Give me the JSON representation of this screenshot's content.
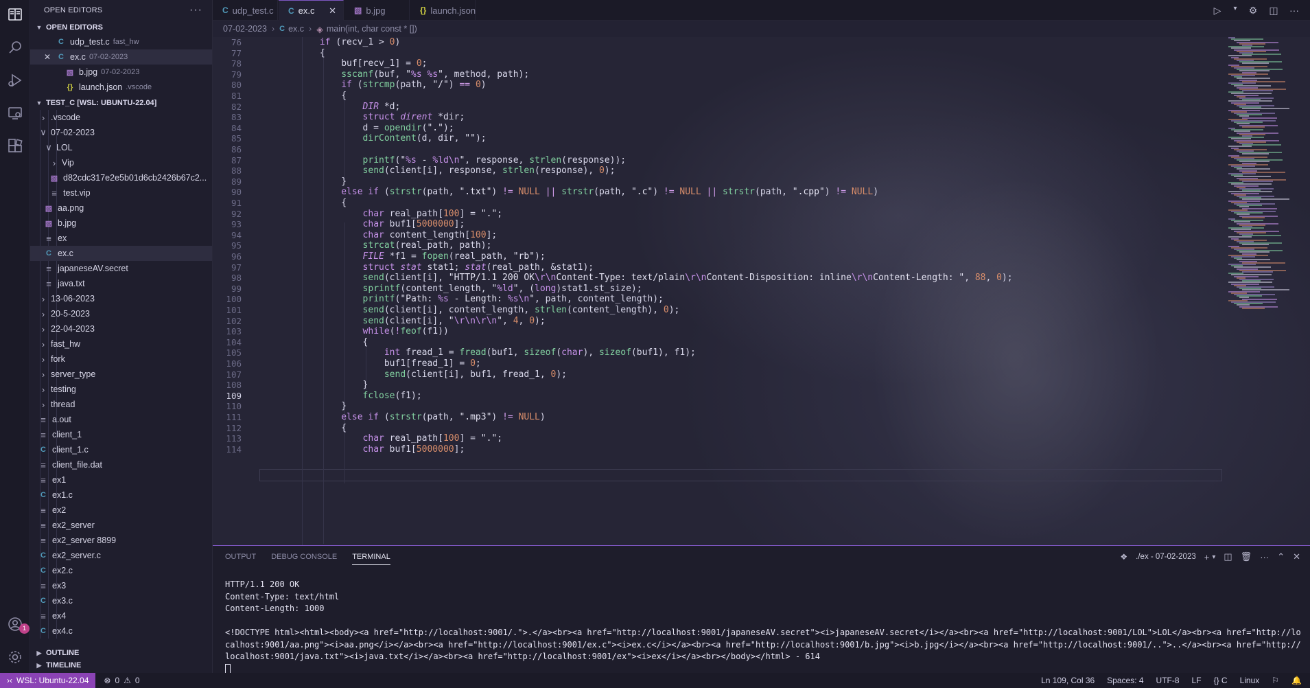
{
  "window": {
    "title": "ex.c - TEST_C [WSL: UBUNTU-22.04]"
  },
  "sidebar": {
    "header": "OPEN EDITORS",
    "open_editors_label": "OPEN EDITORS",
    "open_editors": [
      {
        "name": "udp_test.c",
        "desc": "fast_hw",
        "type": "c"
      },
      {
        "name": "ex.c",
        "desc": "07-02-2023",
        "type": "c"
      },
      {
        "name": "b.jpg",
        "desc": "07-02-2023",
        "type": "img"
      },
      {
        "name": "launch.json",
        "desc": ".vscode",
        "type": "json"
      }
    ],
    "workspace_label": "TEST_C [WSL: UBUNTU-22.04]",
    "tree": [
      {
        "label": ".vscode",
        "depth": 1,
        "kind": "folder-closed"
      },
      {
        "label": "07-02-2023",
        "depth": 1,
        "kind": "folder-open"
      },
      {
        "label": "LOL",
        "depth": 2,
        "kind": "folder-open"
      },
      {
        "label": "Vip",
        "depth": 3,
        "kind": "folder-closed"
      },
      {
        "label": "d82cdc317e2e5b01d6cb2426b67c2...",
        "depth": 3,
        "kind": "img"
      },
      {
        "label": "test.vip",
        "depth": 3,
        "kind": "txt"
      },
      {
        "label": "aa.png",
        "depth": 2,
        "kind": "img"
      },
      {
        "label": "b.jpg",
        "depth": 2,
        "kind": "img"
      },
      {
        "label": "ex",
        "depth": 2,
        "kind": "txt"
      },
      {
        "label": "ex.c",
        "depth": 2,
        "kind": "c"
      },
      {
        "label": "japaneseAV.secret",
        "depth": 2,
        "kind": "txt"
      },
      {
        "label": "java.txt",
        "depth": 2,
        "kind": "txt"
      },
      {
        "label": "13-06-2023",
        "depth": 1,
        "kind": "folder-closed"
      },
      {
        "label": "20-5-2023",
        "depth": 1,
        "kind": "folder-closed"
      },
      {
        "label": "22-04-2023",
        "depth": 1,
        "kind": "folder-closed"
      },
      {
        "label": "fast_hw",
        "depth": 1,
        "kind": "folder-closed"
      },
      {
        "label": "fork",
        "depth": 1,
        "kind": "folder-closed"
      },
      {
        "label": "server_type",
        "depth": 1,
        "kind": "folder-closed"
      },
      {
        "label": "testing",
        "depth": 1,
        "kind": "folder-closed"
      },
      {
        "label": "thread",
        "depth": 1,
        "kind": "folder-closed"
      },
      {
        "label": "a.out",
        "depth": 1,
        "kind": "txt"
      },
      {
        "label": "client_1",
        "depth": 1,
        "kind": "txt"
      },
      {
        "label": "client_1.c",
        "depth": 1,
        "kind": "c"
      },
      {
        "label": "client_file.dat",
        "depth": 1,
        "kind": "txt"
      },
      {
        "label": "ex1",
        "depth": 1,
        "kind": "txt"
      },
      {
        "label": "ex1.c",
        "depth": 1,
        "kind": "c"
      },
      {
        "label": "ex2",
        "depth": 1,
        "kind": "txt"
      },
      {
        "label": "ex2_server",
        "depth": 1,
        "kind": "txt"
      },
      {
        "label": "ex2_server 8899",
        "depth": 1,
        "kind": "txt"
      },
      {
        "label": "ex2_server.c",
        "depth": 1,
        "kind": "c"
      },
      {
        "label": "ex2.c",
        "depth": 1,
        "kind": "c"
      },
      {
        "label": "ex3",
        "depth": 1,
        "kind": "txt"
      },
      {
        "label": "ex3.c",
        "depth": 1,
        "kind": "c"
      },
      {
        "label": "ex4",
        "depth": 1,
        "kind": "txt"
      },
      {
        "label": "ex4.c",
        "depth": 1,
        "kind": "c"
      }
    ],
    "outline_label": "OUTLINE",
    "timeline_label": "TIMELINE"
  },
  "tabs": [
    {
      "name": "udp_test.c",
      "type": "c",
      "active": false
    },
    {
      "name": "ex.c",
      "type": "c",
      "active": true
    },
    {
      "name": "b.jpg",
      "type": "img",
      "active": false
    },
    {
      "name": "launch.json",
      "type": "json",
      "active": false
    }
  ],
  "breadcrumb": {
    "folder": "07-02-2023",
    "file": "ex.c",
    "symbol": "main(int, char const * [])"
  },
  "editor": {
    "current_line": 109,
    "lines": [
      {
        "n": 76,
        "text": "            if (recv_1 > 0)"
      },
      {
        "n": 77,
        "text": "            {"
      },
      {
        "n": 78,
        "text": "                buf[recv_1] = 0;"
      },
      {
        "n": 79,
        "text": "                sscanf(buf, \"%s %s\", method, path);"
      },
      {
        "n": 80,
        "text": "                if (strcmp(path, \"/\") == 0)"
      },
      {
        "n": 81,
        "text": "                {"
      },
      {
        "n": 82,
        "text": "                    DIR *d;"
      },
      {
        "n": 83,
        "text": "                    struct dirent *dir;"
      },
      {
        "n": 84,
        "text": "                    d = opendir(\".\");"
      },
      {
        "n": 85,
        "text": "                    dirContent(d, dir, \"\");"
      },
      {
        "n": 86,
        "text": ""
      },
      {
        "n": 87,
        "text": "                    printf(\"%s - %ld\\n\", response, strlen(response));"
      },
      {
        "n": 88,
        "text": "                    send(client[i], response, strlen(response), 0);"
      },
      {
        "n": 89,
        "text": "                }"
      },
      {
        "n": 90,
        "text": "                else if (strstr(path, \".txt\") != NULL || strstr(path, \".c\") != NULL || strstr(path, \".cpp\") != NULL)"
      },
      {
        "n": 91,
        "text": "                {"
      },
      {
        "n": 92,
        "text": "                    char real_path[100] = \".\";"
      },
      {
        "n": 93,
        "text": "                    char buf1[5000000];"
      },
      {
        "n": 94,
        "text": "                    char content_length[100];"
      },
      {
        "n": 95,
        "text": "                    strcat(real_path, path);"
      },
      {
        "n": 96,
        "text": "                    FILE *f1 = fopen(real_path, \"rb\");"
      },
      {
        "n": 97,
        "text": "                    struct stat stat1; stat(real_path, &stat1);"
      },
      {
        "n": 98,
        "text": "                    send(client[i], \"HTTP/1.1 200 OK\\r\\nContent-Type: text/plain\\r\\nContent-Disposition: inline\\r\\nContent-Length: \", 88, 0);"
      },
      {
        "n": 99,
        "text": "                    sprintf(content_length, \"%ld\", (long)stat1.st_size);"
      },
      {
        "n": 100,
        "text": "                    printf(\"Path: %s - Length: %s\\n\", path, content_length);"
      },
      {
        "n": 101,
        "text": "                    send(client[i], content_length, strlen(content_length), 0);"
      },
      {
        "n": 102,
        "text": "                    send(client[i], \"\\r\\n\\r\\n\", 4, 0);"
      },
      {
        "n": 103,
        "text": "                    while(!feof(f1))"
      },
      {
        "n": 104,
        "text": "                    {"
      },
      {
        "n": 105,
        "text": "                        int fread_1 = fread(buf1, sizeof(char), sizeof(buf1), f1);"
      },
      {
        "n": 106,
        "text": "                        buf1[fread_1] = 0;"
      },
      {
        "n": 107,
        "text": "                        send(client[i], buf1, fread_1, 0);"
      },
      {
        "n": 108,
        "text": "                    }"
      },
      {
        "n": 109,
        "text": "                    fclose(f1);"
      },
      {
        "n": 110,
        "text": "                }"
      },
      {
        "n": 111,
        "text": "                else if (strstr(path, \".mp3\") != NULL)"
      },
      {
        "n": 112,
        "text": "                {"
      },
      {
        "n": 113,
        "text": "                    char real_path[100] = \".\";"
      },
      {
        "n": 114,
        "text": "                    char buf1[5000000];"
      }
    ]
  },
  "panel": {
    "tabs": [
      {
        "label": "OUTPUT",
        "active": false
      },
      {
        "label": "DEBUG CONSOLE",
        "active": false
      },
      {
        "label": "TERMINAL",
        "active": true
      }
    ],
    "terminal_name": "./ex - 07-02-2023",
    "terminal_lines": [
      "HTTP/1.1 200 OK",
      "Content-Type: text/html",
      "Content-Length: 1000",
      "",
      "<!DOCTYPE html><html><body><a href=\"http://localhost:9001/.\">.</a><br><a href=\"http://localhost:9001/japaneseAV.secret\"><i>japaneseAV.secret</i></a><br><a href=\"http://localhost:9001/LOL\">LOL</a><br><a href=\"http://localhost:9001/aa.png\"><i>aa.png</i></a><br><a href=\"http://localhost:9001/ex.c\"><i>ex.c</i></a><br><a href=\"http://localhost:9001/b.jpg\"><i>b.jpg</i></a><br><a href=\"http://localhost:9001/..\">..</a><br><a href=\"http://localhost:9001/java.txt\"><i>java.txt</i></a><br><a href=\"http://localhost:9001/ex\"><i>ex</i></a><br></body></html> - 614"
    ]
  },
  "status": {
    "remote": "WSL: Ubuntu-22.04",
    "errors": "0",
    "warnings": "0",
    "position": "Ln 109, Col 36",
    "spaces": "Spaces: 4",
    "encoding": "UTF-8",
    "eol": "LF",
    "language": "C",
    "platform": "Linux"
  },
  "colors": {
    "accent": "#7e57c2",
    "remote_bg": "#8b43b5",
    "c_icon": "#519aba",
    "json_icon": "#cbcb41",
    "img_icon": "#a074c4"
  },
  "icons": [
    "explorer-icon",
    "search-icon",
    "run-debug-icon",
    "remote-explorer-icon",
    "extensions-icon",
    "account-icon",
    "settings-gear-icon"
  ]
}
